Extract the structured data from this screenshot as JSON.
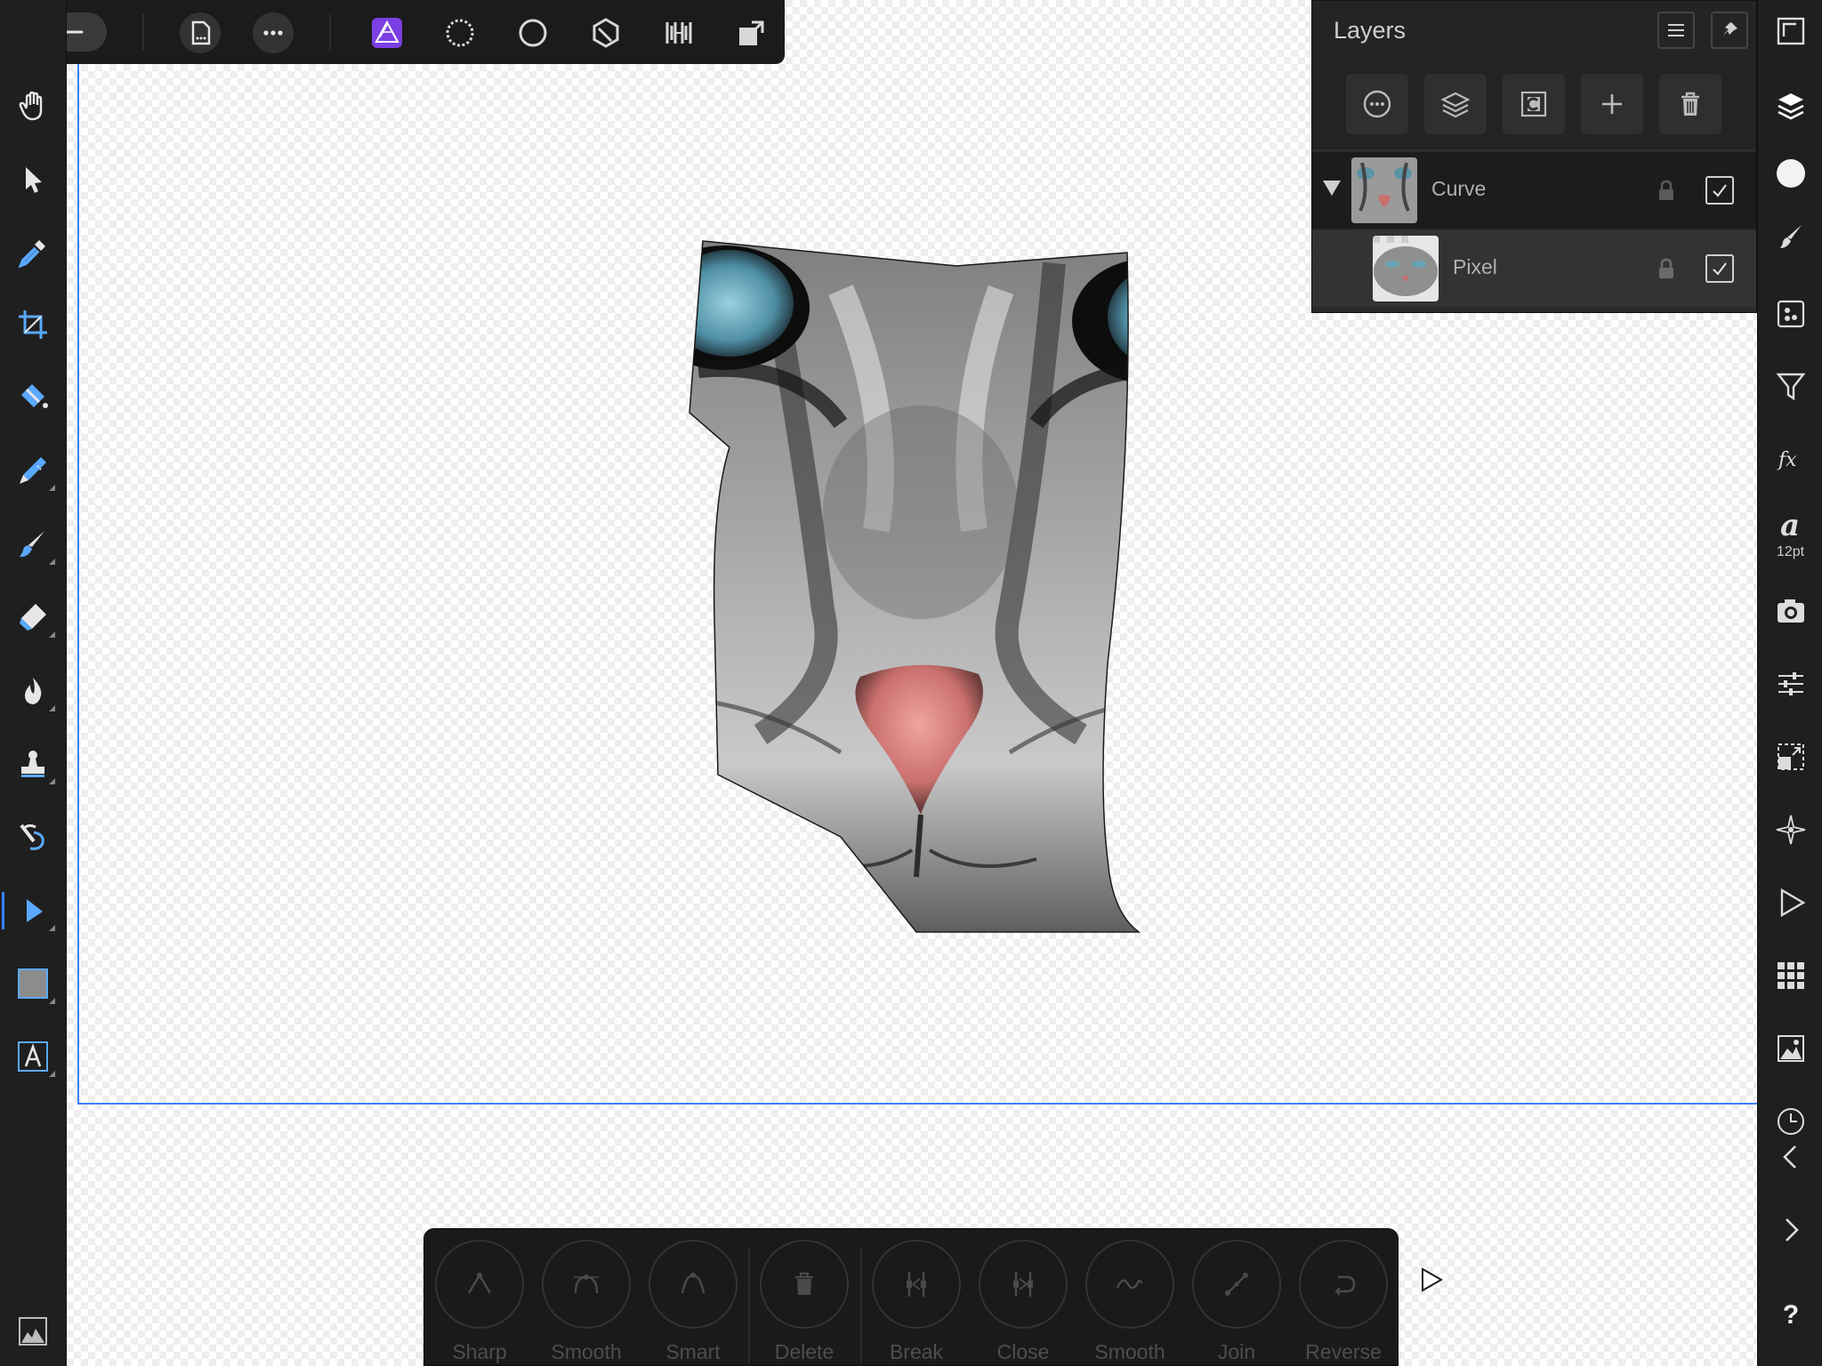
{
  "layers_panel": {
    "title": "Layers",
    "layers": [
      {
        "name": "Curve",
        "visible": true,
        "locked": false,
        "expanded": true
      },
      {
        "name": "Pixel",
        "visible": true,
        "locked": false
      }
    ]
  },
  "right_panel": {
    "font_size": "12pt"
  },
  "context_toolbar": {
    "buttons": [
      {
        "label": "Sharp"
      },
      {
        "label": "Smooth"
      },
      {
        "label": "Smart"
      },
      {
        "label": "Delete"
      },
      {
        "label": "Break"
      },
      {
        "label": "Close"
      },
      {
        "label": "Smooth"
      },
      {
        "label": "Join"
      },
      {
        "label": "Reverse"
      }
    ]
  },
  "help": {
    "label": "?"
  },
  "colors": {
    "accent": "#3b82f6",
    "persona_active": "#7b3fe4",
    "panel_bg": "#2a2a2a",
    "toolbar_bg": "#1f1f1f"
  }
}
